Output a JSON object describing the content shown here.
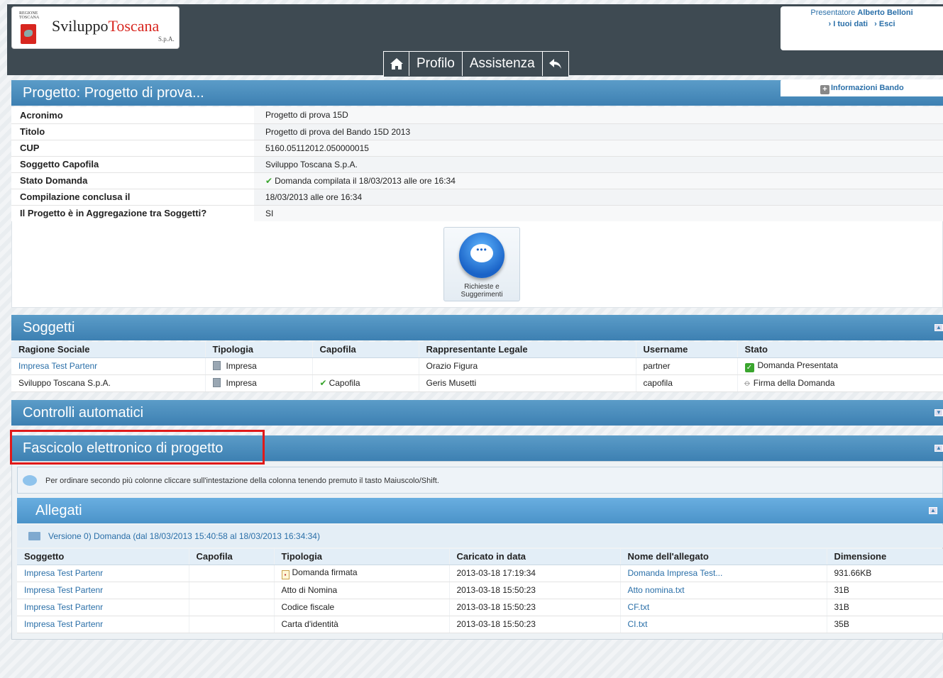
{
  "header": {
    "logo_region": "REGIONE TOSCANA",
    "logo_name_part1": "Sviluppo",
    "logo_name_part2": "Toscana",
    "logo_suffix": "S.p.A.",
    "user_role": "Presentatore",
    "user_name": "Alberto Belloni",
    "link_my_data": "I tuoi dati",
    "link_exit": "Esci",
    "nav": {
      "home_icon": "home-icon",
      "profilo": "Profilo",
      "assistenza": "Assistenza",
      "back_icon": "back-arrow-icon"
    },
    "info_bando": "Informazioni Bando"
  },
  "project": {
    "title": "Progetto: Progetto di prova...",
    "rows": [
      {
        "label": "Acronimo",
        "value": "Progetto di prova 15D"
      },
      {
        "label": "Titolo",
        "value": "Progetto di prova del Bando 15D 2013"
      },
      {
        "label": "CUP",
        "value": "5160.05112012.050000015"
      },
      {
        "label": "Soggetto Capofila",
        "value": "Sviluppo Toscana S.p.A."
      },
      {
        "label": "Stato Domanda",
        "value": "Domanda compilata il 18/03/2013 alle ore 16:34"
      },
      {
        "label": "Compilazione conclusa il",
        "value": "18/03/2013 alle ore 16:34"
      },
      {
        "label": "Il Progetto è in Aggregazione tra Soggetti?",
        "value": "SI"
      }
    ],
    "richieste_button": "Richieste e Suggerimenti"
  },
  "soggetti": {
    "title": "Soggetti",
    "columns": [
      "Ragione Sociale",
      "Tipologia",
      "Capofila",
      "Rappresentante Legale",
      "Username",
      "Stato"
    ],
    "rows": [
      {
        "ragione": "Impresa Test Partenr",
        "tipologia": "Impresa",
        "capofila": "",
        "rappresentante": "Orazio Figura",
        "username": "partner",
        "stato": "Domanda Presentata"
      },
      {
        "ragione": "Sviluppo Toscana S.p.A.",
        "tipologia": "Impresa",
        "capofila": "Capofila",
        "rappresentante": "Geris Musetti",
        "username": "capofila",
        "stato": "Firma della Domanda"
      }
    ]
  },
  "controlli": {
    "title": "Controlli automatici"
  },
  "fascicolo": {
    "title": "Fascicolo elettronico di progetto",
    "hint": "Per ordinare secondo più colonne cliccare sull'intestazione della colonna tenendo premuto il tasto Maiuscolo/Shift.",
    "allegati_title": "Allegati",
    "version_label": "Versione 0) Domanda (dal 18/03/2013 15:40:58 al 18/03/2013 16:34:34)",
    "columns": [
      "Soggetto",
      "Capofila",
      "Tipologia",
      "Caricato in data",
      "Nome dell'allegato",
      "Dimensione"
    ],
    "rows": [
      {
        "soggetto": "Impresa Test Partenr",
        "capofila": "",
        "tipologia": "Domanda firmata",
        "data": "2013-03-18 17:19:34",
        "nome": "Domanda Impresa Test...",
        "dim": "931.66KB"
      },
      {
        "soggetto": "Impresa Test Partenr",
        "capofila": "",
        "tipologia": "Atto di Nomina",
        "data": "2013-03-18 15:50:23",
        "nome": "Atto nomina.txt",
        "dim": "31B"
      },
      {
        "soggetto": "Impresa Test Partenr",
        "capofila": "",
        "tipologia": "Codice fiscale",
        "data": "2013-03-18 15:50:23",
        "nome": "CF.txt",
        "dim": "31B"
      },
      {
        "soggetto": "Impresa Test Partenr",
        "capofila": "",
        "tipologia": "Carta d'identità",
        "data": "2013-03-18 15:50:23",
        "nome": "CI.txt",
        "dim": "35B"
      }
    ]
  }
}
